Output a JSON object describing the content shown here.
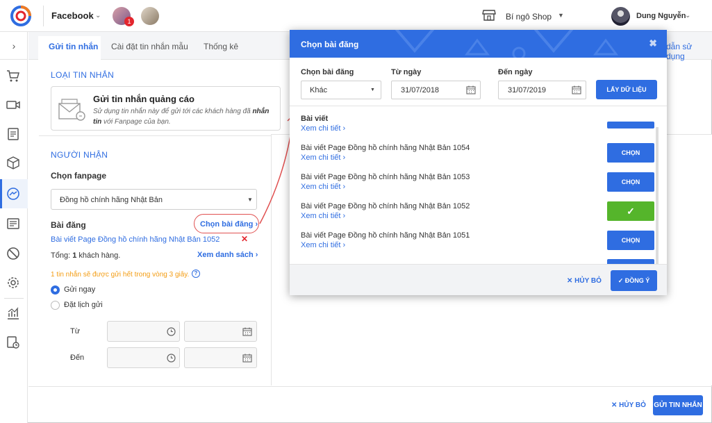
{
  "header": {
    "platform": "Facebook",
    "notification_count": "1",
    "shop_name": "Bí ngô Shop",
    "user_name": "Dung Nguyễn"
  },
  "tabs": [
    "Gửi tin nhắn",
    "Cài đặt tin nhắn mẫu",
    "Thống kê"
  ],
  "help_link": "dẫn sử dụng",
  "message_type": {
    "section_title": "LOẠI TIN NHẮN",
    "card_title": "Gửi tin nhắn quảng cáo",
    "card_desc_1": "Sử dụng tin nhắn này để gửi tới các khách hàng đã ",
    "card_desc_bold": "nhắn tin",
    "card_desc_2": " với Fanpage của bạn."
  },
  "recipient": {
    "section_title": "NGƯỜI NHẬN",
    "fanpage_label": "Chọn fanpage",
    "fanpage_value": "Đồng hồ chính hãng Nhật Bản",
    "post_label": "Bài đăng",
    "choose_post": "Chọn bài đăng",
    "selected_post": "Bài viết Page Đồng hồ chính hãng Nhật Bản 1052",
    "total_prefix": "Tổng: ",
    "total_count": "1",
    "total_suffix": " khách hàng.",
    "view_list": "Xem danh sách",
    "notice": "1 tin nhắn sẽ được gửi hết trong vòng 3 giây.",
    "send_now": "Gửi ngay",
    "schedule": "Đặt lịch gửi",
    "from_label": "Từ",
    "to_label": "Đến"
  },
  "footer": {
    "cancel": "HỦY BỎ",
    "send": "GỬI TIN NHẮN"
  },
  "modal": {
    "title": "Chọn bài đăng",
    "post_type_label": "Chọn bài đăng",
    "post_type_value": "Khác",
    "from_label": "Từ ngày",
    "from_value": "31/07/2018",
    "to_label": "Đến ngày",
    "to_value": "31/07/2019",
    "fetch_button": "LẤY DỮ LIỆU",
    "list_header": "Bài viết",
    "view_detail": "Xem chi tiết",
    "posts": [
      {
        "title": "Bài viết Page Đồng hồ chính hãng Nhật Bản 1054",
        "link": "Xem chi tiết",
        "action": "CHỌN"
      },
      {
        "title": "Bài viết Page Đồng hồ chính hãng Nhật Bản 1053",
        "link": "Xem chi tiết",
        "action": "CHỌN"
      },
      {
        "title": "Bài viết Page Đồng hồ chính hãng Nhật Bản 1052",
        "link": "Xem chi tiết",
        "action": "✓"
      },
      {
        "title": "Bài viết Page Đồng hồ chính hãng Nhật Bản 1051",
        "link": "Xem chi tiết",
        "action": "CHỌN"
      }
    ],
    "cancel": "HỦY BỎ",
    "confirm": "ĐỒNG Ý"
  },
  "colors": {
    "primary": "#2f6de1",
    "success": "#55b52b",
    "warning": "#f39c12",
    "danger": "#e3262e",
    "annotation": "#e05050"
  }
}
